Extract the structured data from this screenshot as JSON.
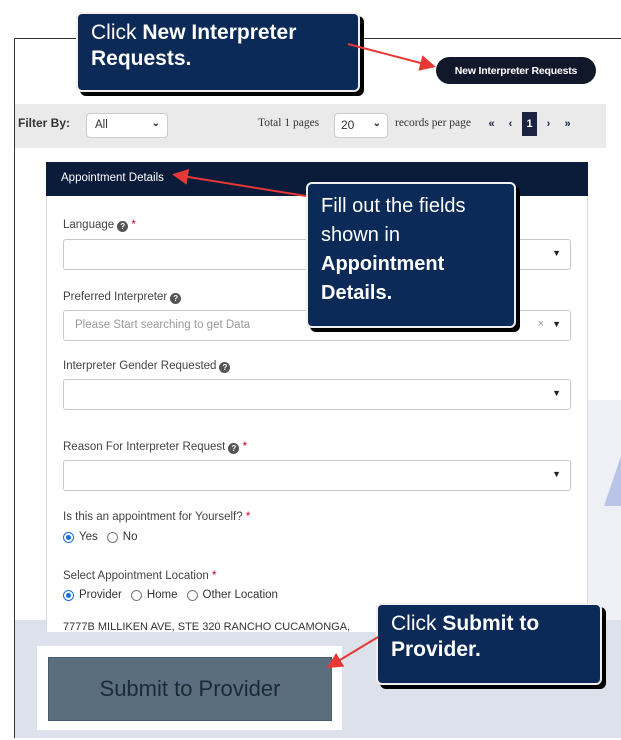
{
  "header": {
    "new_requests_button": "New Interpreter Requests"
  },
  "filter": {
    "label": "Filter By:",
    "value": "All",
    "total_pages": "Total 1 pages",
    "per_page": "20",
    "records_label": "records per page",
    "pager": [
      "«",
      "‹",
      "1",
      "›",
      "»"
    ]
  },
  "panel": {
    "title": "Appointment Details",
    "language_label": "Language",
    "preferred_label": "Preferred Interpreter",
    "preferred_placeholder": "Please Start searching to get Data",
    "gender_label": "Interpreter Gender Requested",
    "reason_label": "Reason For Interpreter Request",
    "self_label": "Is this an appointment for Yourself?",
    "self_options": [
      "Yes",
      "No"
    ],
    "location_label": "Select Appointment Location",
    "location_options": [
      "Provider",
      "Home",
      "Other Location"
    ],
    "address": "7777B MILLIKEN AVE, STE 320 RANCHO CUCAMONGA,",
    "required_mark": "*",
    "help_mark": "?"
  },
  "submit_button": "Submit to Provider",
  "callouts": {
    "c1_prefix": "Click ",
    "c1_bold": "New Interpreter Requests.",
    "c2_text": "Fill out the fields shown in ",
    "c2_bold": "Appointment Details.",
    "c3_prefix": "Click ",
    "c3_bold": "Submit to Provider."
  },
  "colors": {
    "navy": "#0b2a57",
    "arrow": "#e53935",
    "header": "#0b1b3a",
    "submit": "#5a6e80"
  }
}
